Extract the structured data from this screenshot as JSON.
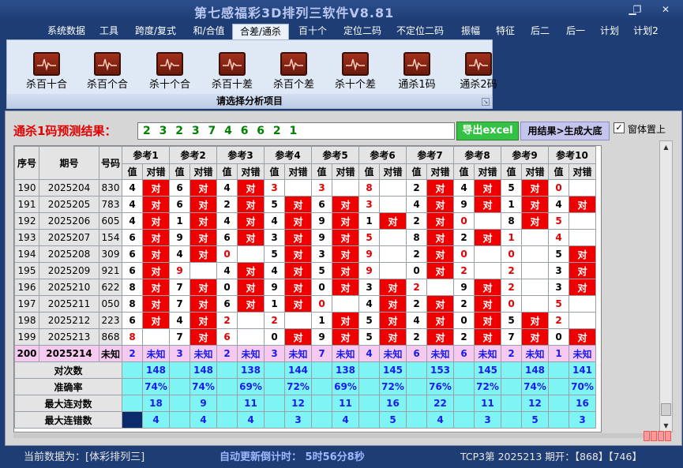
{
  "app": {
    "title": "第七感福彩3D排列三软件V8.81"
  },
  "menu": [
    "系统数据",
    "工具",
    "跨度/复式",
    "和/合值",
    "合差/通杀",
    "百十个",
    "定位二码",
    "不定位二码",
    "振幅",
    "特征",
    "后二",
    "后一",
    "计划",
    "计划2"
  ],
  "menu_active": "合差/通杀",
  "tools": [
    "杀百十合",
    "杀百个合",
    "杀十个合",
    "杀百十差",
    "杀百个差",
    "杀十个差",
    "通杀1码",
    "通杀2码"
  ],
  "panel_caption": "请选择分析项目",
  "result": {
    "label": "通杀1码预测结果：",
    "value": "2 3 2 3 7 4 6 6 2 1",
    "excel_button": "导出excel",
    "generate_button": "用结果>生成大底",
    "ontop_label": "窗体置上",
    "ontop_checked": "✓"
  },
  "table": {
    "headers": {
      "seq": "序号",
      "period": "期号",
      "code": "号码",
      "val": "值",
      "hit": "对错"
    },
    "refs": [
      "参考1",
      "参考2",
      "参考3",
      "参考4",
      "参考5",
      "参考6",
      "参考7",
      "参考8",
      "参考9",
      "参考10"
    ],
    "hit_text": "对",
    "rows": [
      {
        "seq": "190",
        "period": "2025204",
        "code": "830",
        "v": [
          "4",
          "6",
          "4",
          "3",
          "3",
          "8",
          "2",
          "4",
          "5",
          "0"
        ],
        "h": [
          1,
          1,
          1,
          0,
          0,
          0,
          1,
          1,
          1,
          0
        ]
      },
      {
        "seq": "191",
        "period": "2025205",
        "code": "783",
        "v": [
          "4",
          "6",
          "2",
          "5",
          "6",
          "3",
          "4",
          "9",
          "1",
          "4"
        ],
        "h": [
          1,
          1,
          1,
          1,
          1,
          0,
          1,
          1,
          1,
          1
        ]
      },
      {
        "seq": "192",
        "period": "2025206",
        "code": "605",
        "v": [
          "4",
          "1",
          "4",
          "4",
          "9",
          "1",
          "2",
          "0",
          "8",
          "5"
        ],
        "h": [
          1,
          1,
          1,
          1,
          1,
          1,
          1,
          0,
          1,
          0
        ]
      },
      {
        "seq": "193",
        "period": "2025207",
        "code": "154",
        "v": [
          "6",
          "9",
          "6",
          "3",
          "9",
          "5",
          "8",
          "2",
          "1",
          "4"
        ],
        "h": [
          1,
          1,
          1,
          1,
          1,
          0,
          1,
          1,
          0,
          0
        ]
      },
      {
        "seq": "194",
        "period": "2025208",
        "code": "309",
        "v": [
          "6",
          "4",
          "0",
          "5",
          "3",
          "9",
          "2",
          "0",
          "0",
          "5"
        ],
        "h": [
          1,
          1,
          0,
          1,
          1,
          0,
          1,
          0,
          0,
          1
        ]
      },
      {
        "seq": "195",
        "period": "2025209",
        "code": "921",
        "v": [
          "6",
          "9",
          "4",
          "4",
          "5",
          "9",
          "0",
          "2",
          "2",
          "3"
        ],
        "h": [
          1,
          0,
          1,
          1,
          1,
          0,
          1,
          0,
          0,
          1
        ]
      },
      {
        "seq": "196",
        "period": "2025210",
        "code": "622",
        "v": [
          "8",
          "7",
          "0",
          "9",
          "0",
          "3",
          "2",
          "9",
          "2",
          "3"
        ],
        "h": [
          1,
          1,
          1,
          1,
          1,
          1,
          0,
          1,
          0,
          1
        ]
      },
      {
        "seq": "197",
        "period": "2025211",
        "code": "050",
        "v": [
          "8",
          "7",
          "6",
          "1",
          "0",
          "4",
          "2",
          "2",
          "0",
          "5"
        ],
        "h": [
          1,
          1,
          1,
          1,
          0,
          1,
          1,
          1,
          0,
          0
        ]
      },
      {
        "seq": "198",
        "period": "2025212",
        "code": "223",
        "v": [
          "6",
          "4",
          "2",
          "2",
          "1",
          "5",
          "4",
          "0",
          "5",
          "2"
        ],
        "h": [
          1,
          1,
          0,
          0,
          1,
          1,
          1,
          1,
          1,
          0
        ]
      },
      {
        "seq": "199",
        "period": "2025213",
        "code": "868",
        "v": [
          "8",
          "7",
          "6",
          "0",
          "9",
          "5",
          "2",
          "2",
          "7",
          "0"
        ],
        "h": [
          0,
          1,
          0,
          1,
          1,
          1,
          1,
          1,
          1,
          1
        ]
      }
    ],
    "pred": {
      "seq": "200",
      "period": "2025214",
      "code": "未知",
      "v": [
        "2",
        "3",
        "2",
        "3",
        "7",
        "4",
        "6",
        "6",
        "2",
        "1"
      ],
      "unknown": "未知"
    },
    "stats": [
      {
        "label": "对次数",
        "values": [
          "148",
          "148",
          "138",
          "144",
          "138",
          "145",
          "153",
          "145",
          "148",
          "141"
        ]
      },
      {
        "label": "准确率",
        "values": [
          "74%",
          "74%",
          "69%",
          "72%",
          "69%",
          "72%",
          "76%",
          "72%",
          "74%",
          "70%"
        ]
      },
      {
        "label": "最大连对数",
        "values": [
          "18",
          "9",
          "11",
          "12",
          "11",
          "16",
          "22",
          "11",
          "12",
          "16"
        ]
      },
      {
        "label": "最大连错数",
        "values": [
          "4",
          "4",
          "4",
          "3",
          "4",
          "5",
          "4",
          "3",
          "5",
          "3"
        ]
      }
    ]
  },
  "status": {
    "data": "当前数据为：[体彩排列三]",
    "countdown": "自动更新倒计时：  5时56分8秒",
    "issue": "TCP3第 2025213 期开：【868】【746】"
  },
  "colors": {
    "hit": "#ee0000",
    "stat": "#7ff4f4",
    "pred": "#f6caf0",
    "accent": "#33c244"
  }
}
